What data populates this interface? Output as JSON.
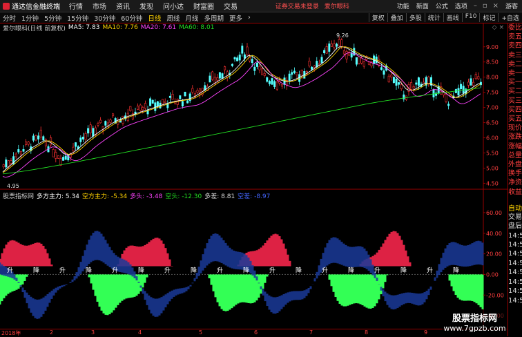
{
  "menubar": {
    "app_title": "通达信金融终端",
    "items": [
      "行情",
      "市场",
      "资讯",
      "发现",
      "问小达",
      "财富圈",
      "交易"
    ],
    "warning": "证券交易未登录",
    "stock_name": "爱尔眼科",
    "right_items": [
      "功能",
      "新面",
      "公式",
      "选项"
    ],
    "guest": "游客"
  },
  "periodbar": {
    "periods": [
      "分时",
      "1分钟",
      "5分钟",
      "15分钟",
      "30分钟",
      "60分钟",
      "日线",
      "周线",
      "月线",
      "多周期",
      "更多"
    ],
    "active": "日线",
    "tools": [
      "复权",
      "叠加",
      "多股",
      "统计",
      "画线",
      "F10",
      "标记",
      "+自选"
    ]
  },
  "main_chart": {
    "title": "爱尔眼科(日线 前复权)",
    "ma": [
      {
        "label": "MA5: 7.83",
        "color": "#ffffff"
      },
      {
        "label": "MA10: 7.76",
        "color": "#ffd200"
      },
      {
        "label": "MA20: 7.61",
        "color": "#ff44ff"
      },
      {
        "label": "MA60: 8.01",
        "color": "#22dd22"
      }
    ],
    "high_label": "9.26",
    "low_label": "4.95",
    "price_ticks": [
      "9.00",
      "8.50",
      "8.00",
      "7.50",
      "7.00",
      "6.50",
      "6.00",
      "5.50",
      "5.00",
      "4.50"
    ]
  },
  "indicator": {
    "name": "股票指标网",
    "items": [
      {
        "label": "多方主力: 5.34",
        "color": "#ffffff"
      },
      {
        "label": "空方主力: -5.34",
        "color": "#ffd200"
      },
      {
        "label": "多头: -3.48",
        "color": "#ff44ff"
      },
      {
        "label": "空头: -12.30",
        "color": "#22dd22"
      },
      {
        "label": "多差: 8.81",
        "color": "#dddddd"
      },
      {
        "label": "空差: -8.97",
        "color": "#4466ff"
      }
    ],
    "ticks": [
      "60.00",
      "40.00",
      "20.00",
      "0.00",
      "-20.00",
      "-40.00"
    ],
    "signal_up": "升",
    "signal_down": "降"
  },
  "side_panel": {
    "labels": [
      "委比",
      "卖五",
      "卖四",
      "卖三",
      "卖二",
      "卖一",
      "买一",
      "买二",
      "买三",
      "买四",
      "买五",
      "现价",
      "涨跌",
      "涨幅",
      "总量",
      "外盘",
      "换手",
      "净资",
      "收益"
    ],
    "auto_label": "自动",
    "sub_labels": [
      "交易",
      "盘后",
      "14:5",
      "14:5",
      "14:5",
      "14:5",
      "14:5",
      "14:5",
      "14:5",
      "14:5"
    ]
  },
  "timeaxis": [
    "2018年",
    "2",
    "3",
    "4",
    "5",
    "6",
    "7",
    "8",
    "9"
  ],
  "watermark": {
    "title": "股票指标网",
    "url": "www.7gpzb.com"
  }
}
